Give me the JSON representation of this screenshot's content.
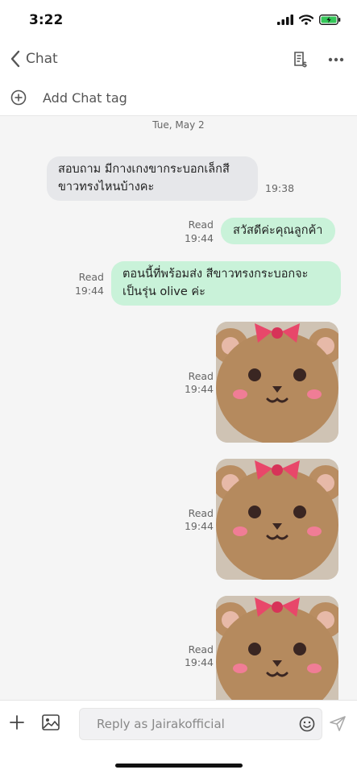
{
  "status_bar": {
    "time": "3:22"
  },
  "nav": {
    "back_label": "Chat"
  },
  "tag_bar": {
    "label": "Add Chat tag"
  },
  "chat": {
    "date": "Tue, May 2",
    "messages": [
      {
        "direction": "in",
        "lines": [
          "สอบถาม มีกางเกงขากระบอกเล็กสี",
          "ขาวทรงไหนบ้างคะ"
        ],
        "time": "19:38"
      },
      {
        "direction": "out",
        "lines": [
          "สวัสดีค่ะคุณลูกค้า"
        ],
        "read": "Read",
        "time": "19:44"
      },
      {
        "direction": "out",
        "lines": [
          "ตอนนี้ที่พร้อมส่ง สีขาวทรงกระบอกจะ",
          "เป็นรุ่น olive ค่ะ"
        ],
        "read": "Read",
        "time": "19:44"
      },
      {
        "direction": "out",
        "type": "image",
        "read": "Read",
        "time": "19:44"
      },
      {
        "direction": "out",
        "type": "image",
        "read": "Read",
        "time": "19:44"
      },
      {
        "direction": "out",
        "type": "image",
        "read": "Read",
        "time": "19:44"
      }
    ]
  },
  "composer": {
    "placeholder": "Reply as Jairakofficial"
  },
  "colors": {
    "outgoing_bubble": "#c9f2d9",
    "incoming_bubble": "#e6e7ea",
    "chat_background": "#f5f5f5"
  },
  "icons": [
    "back-chevron-icon",
    "receipt-icon",
    "more-icon",
    "add-circle-icon",
    "plus-icon",
    "image-icon",
    "emoji-icon",
    "send-icon"
  ]
}
